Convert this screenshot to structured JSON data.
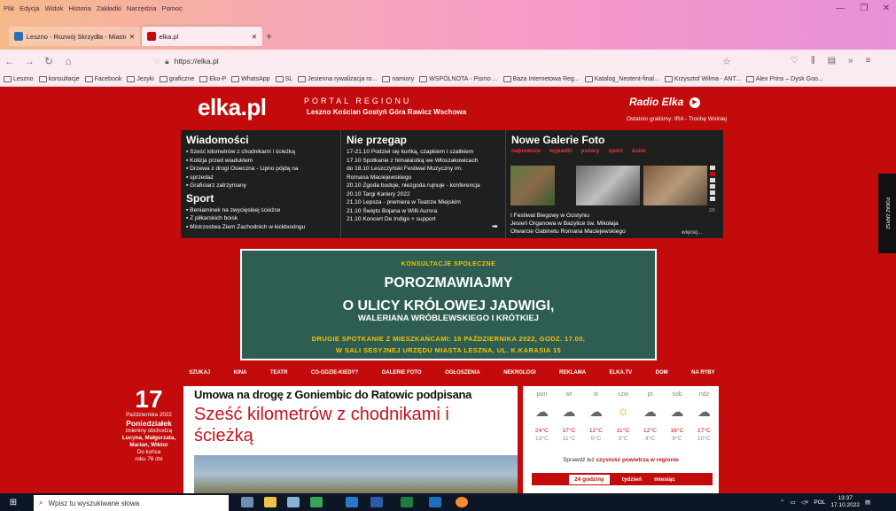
{
  "browser": {
    "menu": [
      "Plik",
      "Edycja",
      "Widok",
      "Historia",
      "Zakładki",
      "Narzędzia",
      "Pomoc"
    ],
    "tabs": [
      {
        "label": "Leszno - Rozwój Skrzydła - Miasto",
        "active": false
      },
      {
        "label": "elka.pl",
        "active": true
      }
    ],
    "url": "https://elka.pl",
    "bookmarks": [
      "Leszno",
      "konsultacje",
      "Facebook",
      "Jezyki",
      "graficzne",
      "Eko-P",
      "WhatsApp",
      "SL",
      "Jesienna rywalizacja ro...",
      "namiory",
      "WSPÓLNOTA - Pismo ...",
      "Baza Internetowa Reg...",
      "Katalog_Neotent-final...",
      "Krzysztof Wilma - ANT...",
      "Alex Prins – Dysk Goo..."
    ]
  },
  "header": {
    "logo": "elka.pl",
    "portal": "PORTAL REGIONU",
    "towns": "Leszno Kościan Gostyń Góra Rawicz Wschowa",
    "radio": "Radio Elka",
    "played": "Ostatnio graliśmy: IRA - Trochę Wolniej"
  },
  "news": {
    "wiadomosci_title": "Wiadomości",
    "wiadomosci": [
      "Sześć kilometrów z chodnikami i ścieżką",
      "Kolizja przed wiaduktem",
      "Drzewa z drogi Osieczna - Lipno pójdą na",
      "sprzedaż",
      "Graficiarz zatrzymany"
    ],
    "sport_title": "Sport",
    "sport": [
      "Beniaminek na zwycięskiej ścieżce",
      "Z piłkarskich boisk",
      "Mistrzostwa Ziem Zachodnich w kickboxingu"
    ],
    "nie_przegap_title": "Nie przegap",
    "nie_przegap": [
      "17-21.10 Podziel się kurtką, czapkiem i szalikiem",
      "17.10 Spotkanie z himalaistką we Włoszakowicach",
      "do 18.10 Leszczyński Festiwal Muzyczny im.",
      "Romana Maciejewskiego",
      "20.10 Zgoda buduje, niezgoda rujnuje - konferencja",
      "20.10 Targi Kariery 2022",
      "21.10 Lepsza - premiera w Teatrze Miejskim",
      "21.10 Święto Bojana w Willi Aurora",
      "21.10 Koncert De Indigo + support"
    ],
    "galerie_title": "Nowe Galerie Foto",
    "galerie_tabs": [
      "najnowsze",
      "wypadki",
      "pożary",
      "sport",
      "żużel"
    ],
    "galerie": [
      "I Festiwal Biegowy w Gostyniu",
      "Jesień Organowa w Bazylice św. Mikołaja",
      "Otwarcie Gabinetu Romana Maciejewskiego"
    ],
    "more": "więcej...",
    "page": "2/6"
  },
  "banner": {
    "kicker": "KONSULTACJE SPOŁECZNE",
    "h1a": "POROZMAWIAJMY",
    "h1b": "O ULICY KRÓLOWEJ JADWIGI,",
    "h2": "WALERIANA WRÓBLEWSKIEGO I KRÓTKIEJ",
    "b1": "DRUGIE SPOTKANIE Z MIESZKAŃCAMI: 18 PAŹDZIERNIKA 2022, GODZ. 17.00,",
    "b2": "W SALI SESYJNEJ URZĘDU MIASTA LESZNA, UL. K.KARASIA 15"
  },
  "sections": [
    "SZUKAJ",
    "KINA",
    "TEATR",
    "CO-GDZIE-KIEDY?",
    "GALERIE FOTO",
    "OGŁOSZENIA",
    "NEKROLOGI",
    "REKLAMA",
    "ELKA.TV",
    "DOM",
    "NA RYBY"
  ],
  "date": {
    "day": "17",
    "month": "Października 2022",
    "weekday": "Poniedziałek",
    "names_label": "imieniny obchodzą",
    "names": "Lucyna, Małgorzata, Marian, Wiktor",
    "left1": "Do końca",
    "left2": "roku 76 dni"
  },
  "article": {
    "small": "Umowa na drogę z Goniembic do Ratowic podpisana",
    "headline": "Sześć kilometrów z chodnikami i ścieżką"
  },
  "weather": {
    "days": [
      "pon",
      "wt",
      "śr",
      "czw",
      "pt",
      "sob",
      "ndz"
    ],
    "icons": [
      "☁",
      "☁",
      "☁",
      "☼",
      "☁",
      "☁",
      "☁"
    ],
    "day_temps": [
      "24°C",
      "17°C",
      "12°C",
      "11°C",
      "12°C",
      "16°C",
      "17°C"
    ],
    "night_temps": [
      "13°C",
      "11°C",
      "5°C",
      "3°C",
      "4°C",
      "9°C",
      "10°C"
    ],
    "airq_pre": "Sprawdź też",
    "airq_link": "czystość powietrza w regionie",
    "tabs": [
      "24 godziny",
      "tydzień",
      "miesiąc"
    ]
  },
  "sidetab": "POKAŻ ZAPISZ",
  "taskbar": {
    "search": "Wpisz tu wyszukiwane słowa",
    "lang": "POL",
    "time": "13:37",
    "date": "17.10.2022"
  }
}
